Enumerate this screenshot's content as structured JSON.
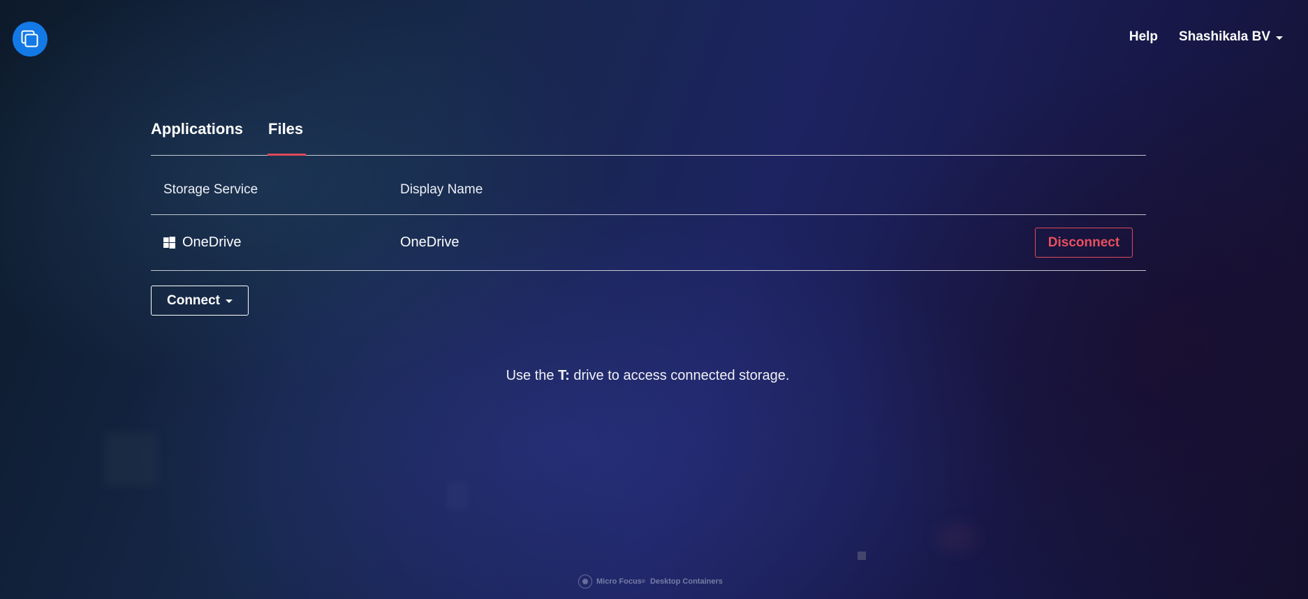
{
  "header": {
    "logo_icon": "app-layers-icon",
    "help_label": "Help",
    "user_name": "Shashikala BV"
  },
  "tabs": [
    {
      "label": "Applications",
      "active": false
    },
    {
      "label": "Files",
      "active": true
    }
  ],
  "table": {
    "columns": [
      "Storage Service",
      "Display Name"
    ],
    "rows": [
      {
        "service": "OneDrive",
        "service_icon": "windows-icon",
        "display_name": "OneDrive",
        "action_label": "Disconnect"
      }
    ]
  },
  "connect_label": "Connect",
  "hint": {
    "prefix": "Use the",
    "drive": "T:",
    "suffix": "drive to access connected storage."
  },
  "footer": {
    "brand": "Micro Focus",
    "trademark": "®",
    "product": "Desktop Containers"
  },
  "colors": {
    "accent_red": "#e04a5a",
    "logo_blue": "#1279e6"
  }
}
